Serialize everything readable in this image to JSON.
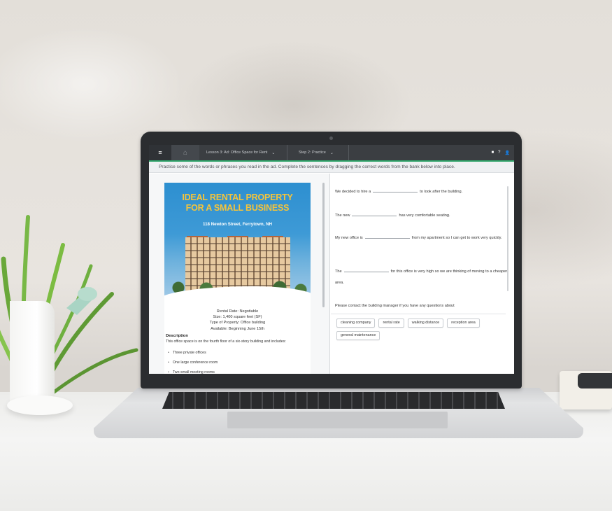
{
  "topbar": {
    "lesson_label": "Lesson 3: Ad: Office Space for Rent",
    "step_label": "Step 2: Practice",
    "caret": "⌄",
    "menu_icon": "≡",
    "home_icon": "⌂",
    "right_icons": [
      "■",
      "?",
      "👤"
    ]
  },
  "instruction": "Practice some of the words or phrases you read in the ad. Complete the sentences by dragging the correct words from the bank below into place.",
  "ad": {
    "title_line1": "IDEAL RENTAL PROPERTY",
    "title_line2": "FOR A SMALL BUSINESS",
    "address": "118 Newton Street, Ferrytown, NH",
    "info": [
      "Rental Rate: Negotiable",
      "Size: 1,400 square feet (SF)",
      "Type of Property: Office building",
      "Available: Beginning June 15th"
    ],
    "description_heading": "Description",
    "description_text": "This office space is on the fourth floor of a six-story building and includes:",
    "features": [
      "Three private offices",
      "One large conference room",
      "Two small meeting rooms"
    ]
  },
  "exercise": {
    "sentences": [
      {
        "before": "We decided to hire a",
        "after": "to look after the building."
      },
      {
        "before": "The new",
        "after": "has very comfortable seating."
      },
      {
        "before": "My new office is",
        "after": "from my apartment so I can get to work very quickly."
      },
      {
        "before": "The",
        "after": "for this office is very high so we are thinking of moving to a cheaper area."
      },
      {
        "before": "Please contact the building manager if you have any questions about",
        "after": ""
      }
    ],
    "word_bank": [
      "cleaning company",
      "rental rate",
      "walking distance",
      "reception area",
      "general maintenance"
    ]
  },
  "colors": {
    "accent": "#2fa56a",
    "topbar": "#3b3e42",
    "ad_title": "#f5c43a",
    "ad_sky": "#2d8fd0"
  }
}
